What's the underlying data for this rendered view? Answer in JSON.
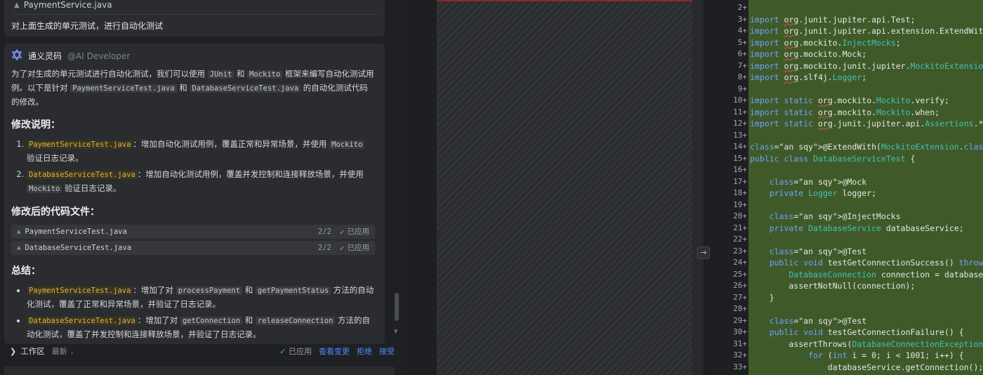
{
  "chat": {
    "top_file": "PaymentService.java",
    "user_message": "对上面生成的单元测试，进行自动化测试",
    "ai_name": "通义灵码",
    "ai_role": "@AI Developer",
    "intro_1": "为了对生成的单元测试进行自动化测试，我们可以使用",
    "intro_junit": "JUnit",
    "intro_and": "和",
    "intro_mockito": "Mockito",
    "intro_2": "框架来编写自动化测试用例。以下是针对",
    "intro_file1": "PaymentServiceTest.java",
    "intro_and2": "和",
    "intro_file2": "DatabaseServiceTest.java",
    "intro_3": "的自动化测试代码的修改。",
    "h_changes": "修改说明：",
    "change1_file": "PaymentServiceTest.java",
    "change1_text": "：增加自动化测试用例，覆盖正常和异常场景，并使用",
    "change1_mockito": "Mockito",
    "change1_end": "验证日志记录。",
    "change2_file": "DatabaseServiceTest.java",
    "change2_text": "：增加自动化测试用例，覆盖并发控制和连接释放场景，并使用",
    "change2_mockito": "Mockito",
    "change2_end": "验证日志记录。",
    "h_files": "修改后的代码文件：",
    "files": [
      {
        "name": "PaymentServiceTest.java",
        "count": "2/2",
        "status": "已应用"
      },
      {
        "name": "DatabaseServiceTest.java",
        "count": "2/2",
        "status": "已应用"
      }
    ],
    "h_summary": "总结：",
    "sum1_file": "PaymentServiceTest.java",
    "sum1_a": "：增加了对",
    "sum1_m1": "processPayment",
    "sum1_and": "和",
    "sum1_m2": "getPaymentStatus",
    "sum1_b": "方法的自动化测试，覆盖了正常和异常场景，并验证了日志记录。",
    "sum2_file": "DatabaseServiceTest.java",
    "sum2_a": "：增加了对",
    "sum2_m1": "getConnection",
    "sum2_and": "和",
    "sum2_m2": "releaseConnection",
    "sum2_b": "方法的自动化测试，覆盖了并发控制和连接释放场景，并验证了日志记录。"
  },
  "workspace": {
    "label": "工作区",
    "sort": "最新",
    "applied": "已应用",
    "view_changes": "查看变更",
    "reject": "拒绝",
    "accept": "接受"
  },
  "code_lines": [
    {
      "n": "2+",
      "t": ""
    },
    {
      "n": "3+",
      "t": "import org.junit.jupiter.api.Test;"
    },
    {
      "n": "4+",
      "t": "import org.junit.jupiter.api.extension.ExtendWith;"
    },
    {
      "n": "5+",
      "t": "import org.mockito.InjectMocks;"
    },
    {
      "n": "6+",
      "t": "import org.mockito.Mock;"
    },
    {
      "n": "7+",
      "t": "import org.mockito.junit.jupiter.MockitoExtension;"
    },
    {
      "n": "8+",
      "t": "import org.slf4j.Logger;"
    },
    {
      "n": "9+",
      "t": ""
    },
    {
      "n": "10+",
      "t": "import static org.mockito.Mockito.verify;"
    },
    {
      "n": "11+",
      "t": "import static org.mockito.Mockito.when;"
    },
    {
      "n": "12+",
      "t": "import static org.junit.jupiter.api.Assertions.*;"
    },
    {
      "n": "13+",
      "t": ""
    },
    {
      "n": "14+",
      "t": "@ExtendWith(MockitoExtension.class)"
    },
    {
      "n": "15+",
      "t": "public class DatabaseServiceTest {"
    },
    {
      "n": "16+",
      "t": ""
    },
    {
      "n": "17+",
      "t": "    @Mock"
    },
    {
      "n": "18+",
      "t": "    private Logger logger;"
    },
    {
      "n": "19+",
      "t": ""
    },
    {
      "n": "20+",
      "t": "    @InjectMocks"
    },
    {
      "n": "21+",
      "t": "    private DatabaseService databaseService;"
    },
    {
      "n": "22+",
      "t": ""
    },
    {
      "n": "23+",
      "t": "    @Test"
    },
    {
      "n": "24+",
      "t": "    public void testGetConnectionSuccess() throws"
    },
    {
      "n": "25+",
      "t": "        DatabaseConnection connection = databaseSe"
    },
    {
      "n": "26+",
      "t": "        assertNotNull(connection);"
    },
    {
      "n": "27+",
      "t": "    }"
    },
    {
      "n": "28+",
      "t": ""
    },
    {
      "n": "29+",
      "t": "    @Test"
    },
    {
      "n": "30+",
      "t": "    public void testGetConnectionFailure() {"
    },
    {
      "n": "31+",
      "t": "        assertThrows(DatabaseConnectionException.c"
    },
    {
      "n": "32+",
      "t": "            for (int i = 0; i < 1001; i++) {"
    },
    {
      "n": "33+",
      "t": "                databaseService.getConnection();"
    }
  ]
}
